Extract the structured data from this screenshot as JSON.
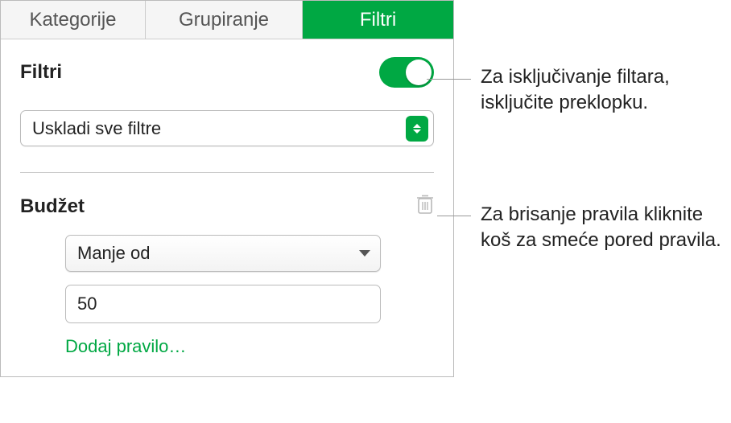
{
  "tabs": {
    "kategorije": "Kategorije",
    "grupiranje": "Grupiranje",
    "filtri": "Filtri"
  },
  "section": {
    "title": "Filtri"
  },
  "match_select": {
    "value": "Uskladi sve filtre"
  },
  "rule": {
    "title": "Budžet",
    "condition": "Manje od",
    "value": "50",
    "add_rule": "Dodaj pravilo…"
  },
  "callouts": {
    "toggle": "Za isključivanje filtara, isključite preklopku.",
    "trash": "Za brisanje pravila kliknite koš za smeće pored pravila."
  }
}
